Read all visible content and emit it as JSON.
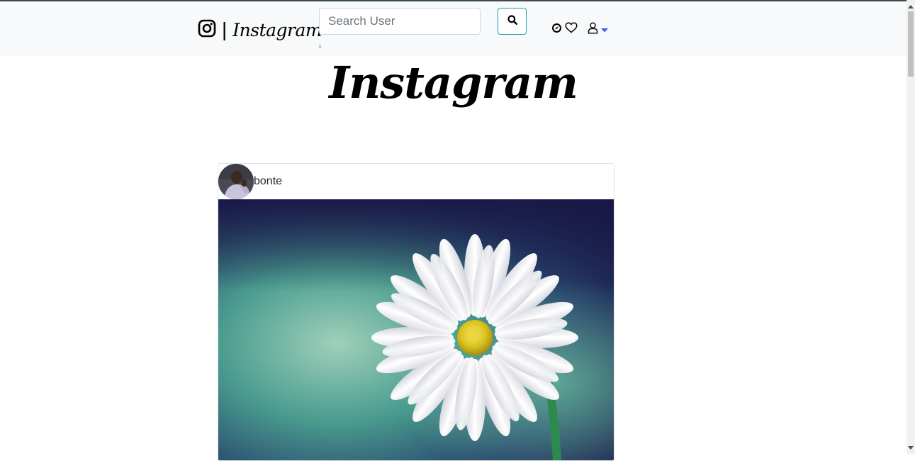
{
  "navbar": {
    "brand_divider": "|",
    "brand_name": "Instagram",
    "search_placeholder": "Search User",
    "icons": [
      "instagram-icon",
      "search-icon",
      "compass-icon",
      "heart-icon",
      "user-icon",
      "caret-down-icon"
    ],
    "caret_color": "#3b5bfd"
  },
  "hero": {
    "title": "Instagram"
  },
  "post": {
    "username": "bonte",
    "image": "daisy-flower-photo"
  }
}
